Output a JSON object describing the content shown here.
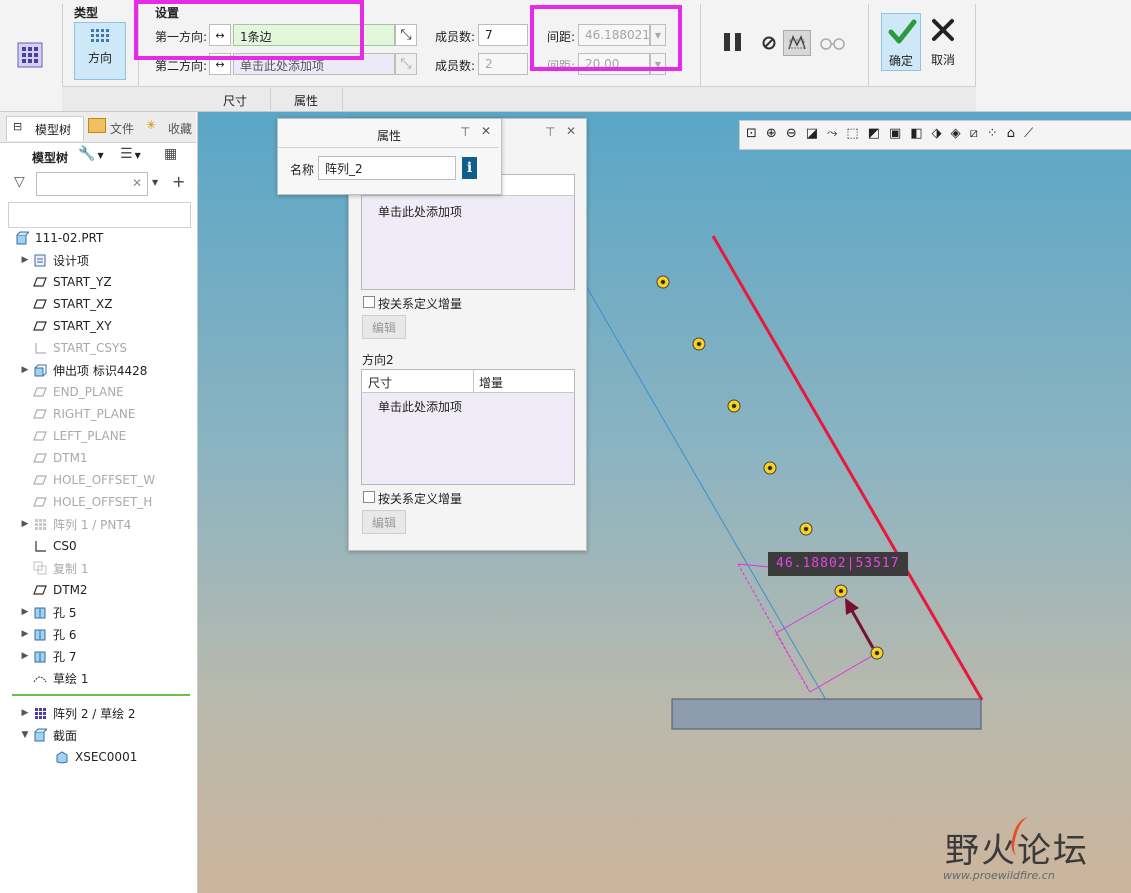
{
  "ribbon": {
    "type_group_title": "类型",
    "type_button_label": "方向",
    "settings_title": "设置",
    "dir1_label": "第一方向:",
    "dir1_value": "1条边",
    "dir2_label": "第二方向:",
    "dir2_placeholder": "单击此处添加项",
    "members1_label": "成员数:",
    "members1_value": "7",
    "members2_label": "成员数:",
    "members2_value": "2",
    "spacing1_label": "间距:",
    "spacing1_value": "46.1880215",
    "spacing2_label": "间距:",
    "spacing2_value": "20.00",
    "ok_label": "确定",
    "cancel_label": "取消",
    "tabs": [
      "尺寸",
      "属性"
    ]
  },
  "left_panel": {
    "tabs": [
      "模型树",
      "文件",
      "收藏"
    ],
    "tree_title": "模型树",
    "items": [
      {
        "label": "111-02.PRT",
        "icon": "part-icon",
        "expand": "",
        "dim": false
      },
      {
        "label": "设计项",
        "icon": "design-items-icon",
        "expand": "▶",
        "dim": false
      },
      {
        "label": "START_YZ",
        "icon": "datum-plane-icon",
        "expand": "",
        "dim": false
      },
      {
        "label": "START_XZ",
        "icon": "datum-plane-icon",
        "expand": "",
        "dim": false
      },
      {
        "label": "START_XY",
        "icon": "datum-plane-icon",
        "expand": "",
        "dim": false
      },
      {
        "label": "START_CSYS",
        "icon": "csys-icon",
        "expand": "",
        "dim": true
      },
      {
        "label": "伸出项 标识4428",
        "icon": "extrude-icon",
        "expand": "▶",
        "dim": false
      },
      {
        "label": "END_PLANE",
        "icon": "datum-plane-icon",
        "expand": "",
        "dim": true
      },
      {
        "label": "RIGHT_PLANE",
        "icon": "datum-plane-icon",
        "expand": "",
        "dim": true
      },
      {
        "label": "LEFT_PLANE",
        "icon": "datum-plane-icon",
        "expand": "",
        "dim": true
      },
      {
        "label": "DTM1",
        "icon": "datum-plane-icon",
        "expand": "",
        "dim": true
      },
      {
        "label": "HOLE_OFFSET_W",
        "icon": "datum-plane-icon",
        "expand": "",
        "dim": true
      },
      {
        "label": "HOLE_OFFSET_H",
        "icon": "datum-plane-icon",
        "expand": "",
        "dim": true
      },
      {
        "label": "阵列 1 / PNT4",
        "icon": "pattern-icon",
        "expand": "▶",
        "dim": true
      },
      {
        "label": "CS0",
        "icon": "csys-icon",
        "expand": "",
        "dim": false
      },
      {
        "label": "复制 1",
        "icon": "copy-icon",
        "expand": "",
        "dim": true
      },
      {
        "label": "DTM2",
        "icon": "datum-plane-icon",
        "expand": "",
        "dim": false
      },
      {
        "label": "孔 5",
        "icon": "hole-icon",
        "expand": "▶",
        "dim": false
      },
      {
        "label": "孔 6",
        "icon": "hole-icon",
        "expand": "▶",
        "dim": false
      },
      {
        "label": "孔 7",
        "icon": "hole-icon",
        "expand": "▶",
        "dim": false
      },
      {
        "label": "草绘 1",
        "icon": "sketch-icon",
        "expand": "",
        "dim": false
      }
    ],
    "after_insert": [
      {
        "label": "阵列 2 / 草绘 2",
        "icon": "pattern-icon",
        "expand": "▶"
      },
      {
        "label": "截面",
        "icon": "section-icon",
        "expand": "▼"
      },
      {
        "label": "XSEC0001",
        "icon": "xsec-icon",
        "expand": ""
      }
    ]
  },
  "name_panel": {
    "title": "属性",
    "name_label": "名称",
    "name_value": "阵列_2"
  },
  "dim_panel": {
    "list1_placeholder": "单击此处添加项",
    "relation1_label": "按关系定义增量",
    "edit1_label": "编辑",
    "direction2_title": "方向2",
    "col_dim": "尺寸",
    "col_inc": "增量",
    "list2_placeholder": "单击此处添加项",
    "relation2_label": "按关系定义增量",
    "edit2_label": "编辑"
  },
  "viewport": {
    "dim_value": "46.18802|53517"
  },
  "watermark": {
    "text": "野火论坛",
    "url": "www.proewildfire.cn"
  },
  "colors": {
    "highlight": "#e62be6",
    "red_edge": "#e8183c",
    "dim_magenta": "#e030e0",
    "arrow": "#7a1030"
  }
}
